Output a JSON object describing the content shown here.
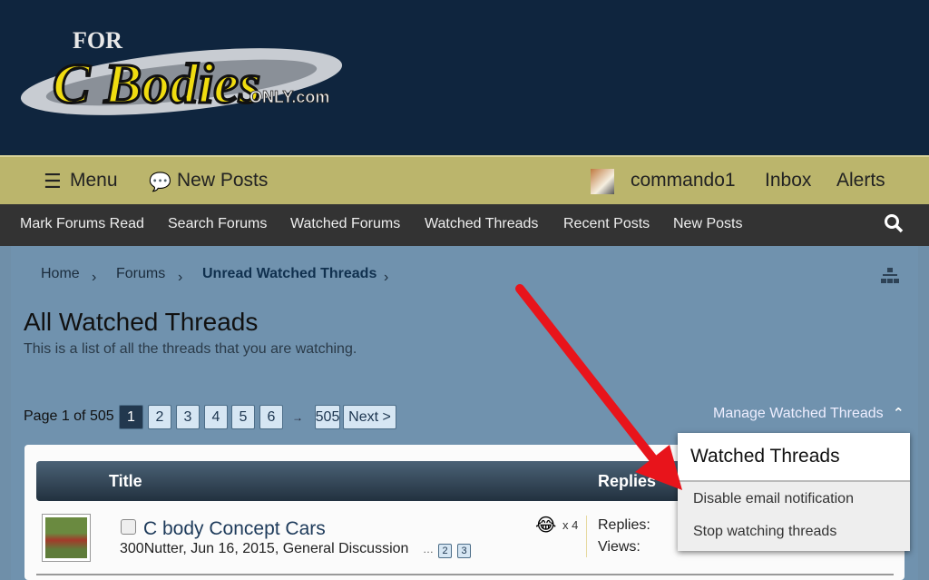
{
  "logo": {
    "text": "For C Bodies Only.com"
  },
  "topbar": {
    "menu": "Menu",
    "new_posts": "New Posts",
    "user": "commando1",
    "inbox": "Inbox",
    "alerts": "Alerts"
  },
  "nav": {
    "items": [
      "Mark Forums Read",
      "Search Forums",
      "Watched Forums",
      "Watched Threads",
      "Recent Posts",
      "New Posts"
    ]
  },
  "breadcrumb": [
    "Home",
    "Forums",
    "Unread Watched Threads"
  ],
  "page": {
    "title": "All Watched Threads",
    "subtitle": "This is a list of all the threads that you are watching."
  },
  "pagination": {
    "label": "Page 1 of 505",
    "pages": [
      "1",
      "2",
      "3",
      "4",
      "5",
      "6"
    ],
    "ellipsis": "→",
    "last": "505",
    "next": "Next >",
    "current": 1
  },
  "manage": {
    "label": "Manage Watched Threads"
  },
  "table": {
    "col_title": "Title",
    "col_replies": "Replies"
  },
  "thread": {
    "title": "C body Concept Cars",
    "author": "300Nutter",
    "date": "Jun 16, 2015",
    "forum": "General Discussion",
    "pages": [
      "2",
      "3"
    ],
    "reaction_count": "x 4",
    "replies_label": "Replies:",
    "views_label": "Views:"
  },
  "dropdown": {
    "title": "Watched Threads",
    "items": [
      "Disable email notification",
      "Stop watching threads"
    ]
  },
  "colors": {
    "header": "#0f253e",
    "topbar": "#bbb56c",
    "nav": "#333333",
    "arrow": "#e8141b"
  }
}
